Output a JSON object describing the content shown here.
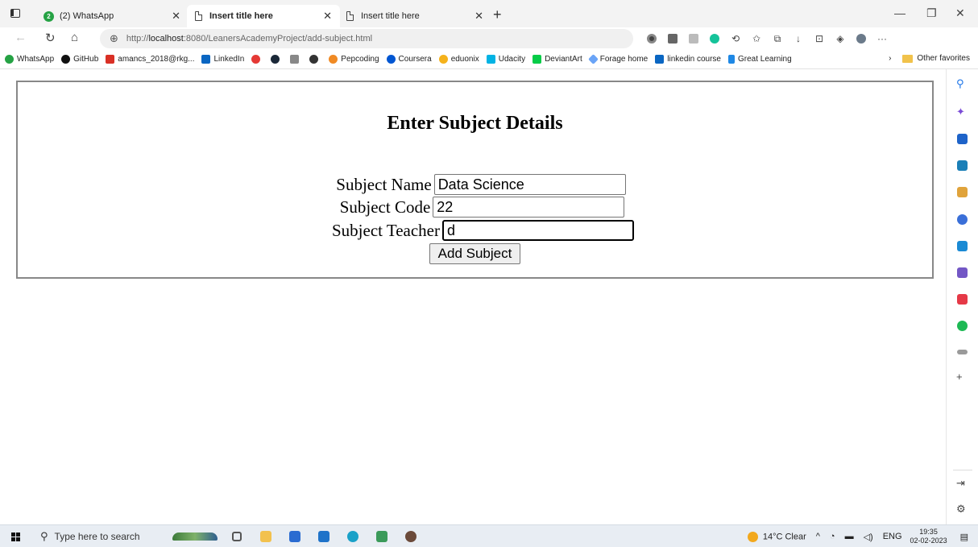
{
  "browser": {
    "tabs": [
      {
        "title": "(2) WhatsApp",
        "badge": "2"
      },
      {
        "title": "Insert title here"
      },
      {
        "title": "Insert title here"
      }
    ],
    "url": {
      "scheme": "http://",
      "host": "localhost",
      "rest": ":8080/LeanersAcademyProject/add-subject.html"
    },
    "bookmarks": [
      {
        "label": "WhatsApp",
        "color": "#25a244"
      },
      {
        "label": "GitHub",
        "color": "#111111"
      },
      {
        "label": "amancs_2018@rkg...",
        "color": "#d93025"
      },
      {
        "label": "LinkedIn",
        "color": "#0a66c2"
      },
      {
        "label": "",
        "color": "#e53935"
      },
      {
        "label": "",
        "color": "#1b2838"
      },
      {
        "label": "",
        "color": "#888888"
      },
      {
        "label": "",
        "color": "#333333"
      },
      {
        "label": "Pepcoding",
        "color": "#f08a24"
      },
      {
        "label": "Coursera",
        "color": "#0056d2"
      },
      {
        "label": "eduonix",
        "color": "#f5b21b"
      },
      {
        "label": "Udacity",
        "color": "#02b3e4"
      },
      {
        "label": "DeviantArt",
        "color": "#05cc47"
      },
      {
        "label": "Forage home",
        "color": "#6aa4f7"
      },
      {
        "label": "linkedin course",
        "color": "#0a66c2"
      },
      {
        "label": "Great Learning",
        "color": "#1e88e5"
      }
    ],
    "other_favorites": "Other favorites"
  },
  "form": {
    "title": "Enter Subject Details",
    "subject_name_label": "Subject Name",
    "subject_name_value": "Data Science",
    "subject_code_label": "Subject Code",
    "subject_code_value": "22",
    "subject_teacher_label": "Subject Teacher",
    "subject_teacher_value": "d",
    "submit_label": "Add Subject"
  },
  "taskbar": {
    "search_placeholder": "Type here to search",
    "weather": "14°C Clear",
    "language": "ENG",
    "time": "19:35",
    "date": "02-02-2023"
  }
}
